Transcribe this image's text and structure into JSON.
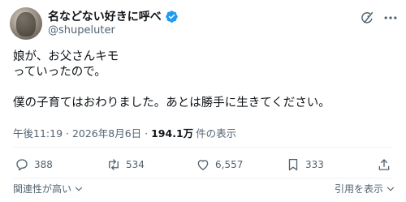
{
  "author": {
    "display_name": "名などない好きに呼べ",
    "handle": "@shupeluter",
    "verified": true
  },
  "icons": {
    "verified": "verified-badge-icon",
    "grok": "grok-icon",
    "more": "more-dots-icon",
    "reply": "reply-icon",
    "repost": "repost-icon",
    "like": "like-icon",
    "bookmark": "bookmark-icon",
    "share": "share-icon",
    "chevron": "chevron-down-icon"
  },
  "tweet": {
    "lines": [
      "娘が、お父さんキモ",
      "っていったので。",
      "",
      "僕の子育てはおわりました。あとは勝手に生きてください。"
    ],
    "timestamp": "午後11:19 · 2026年8月6日 ·",
    "views_count": "194.1万",
    "views_label": "件の表示"
  },
  "actions": {
    "replies": "388",
    "reposts": "534",
    "likes": "6,557",
    "bookmarks": "333"
  },
  "footer": {
    "sort_label": "関連性が高い",
    "quotes_label": "引用を表示"
  },
  "colors": {
    "text": "#0f1419",
    "secondary": "#536471",
    "verified": "#1d9bf0",
    "divider": "#eff3f4"
  }
}
